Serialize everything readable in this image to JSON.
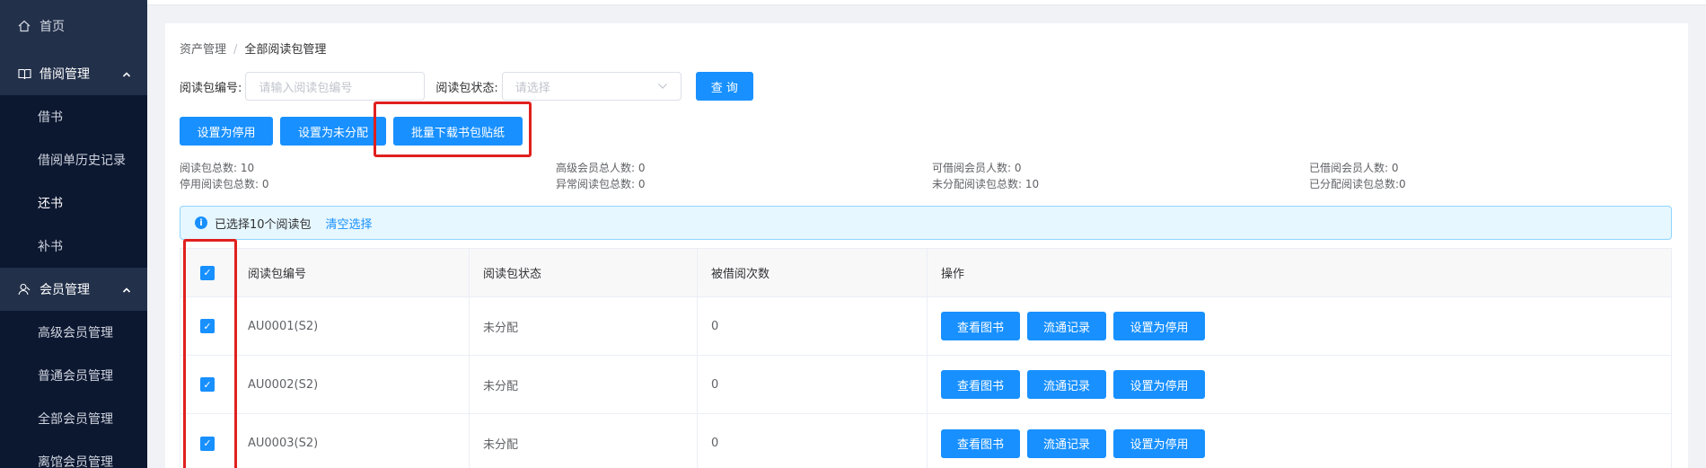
{
  "sidebar": {
    "home": "首页",
    "borrow_group": {
      "label": "借阅管理",
      "items": [
        "借书",
        "借阅单历史记录",
        "还书",
        "补书"
      ]
    },
    "member_group": {
      "label": "会员管理",
      "items": [
        "高级会员管理",
        "普通会员管理",
        "全部会员管理",
        "离馆会员管理"
      ]
    }
  },
  "breadcrumb": {
    "parent": "资产管理",
    "separator": "/",
    "current": "全部阅读包管理"
  },
  "filter": {
    "code_label": "阅读包编号:",
    "code_placeholder": "请输入阅读包编号",
    "status_label": "阅读包状态:",
    "status_placeholder": "请选择",
    "query_button": "查 询"
  },
  "actions": {
    "set_disabled": "设置为停用",
    "set_unassigned": "设置为未分配",
    "batch_download": "批量下载书包贴纸"
  },
  "stats": {
    "total": "阅读包总数: 10",
    "disabled": "停用阅读包总数: 0",
    "premium_members": "高级会员总人数: 0",
    "abnormal": "异常阅读包总数: 0",
    "borrowable_members": "可借阅会员人数: 0",
    "unassigned": "未分配阅读包总数: 10",
    "borrowed_members": "已借阅会员人数: 0",
    "assigned": "已分配阅读包总数:0"
  },
  "alert": {
    "text": "已选择10个阅读包",
    "clear": "清空选择"
  },
  "table": {
    "headers": {
      "code": "阅读包编号",
      "status": "阅读包状态",
      "count": "被借阅次数",
      "ops": "操作"
    },
    "rows": [
      {
        "code": "AU0001(S2)",
        "status": "未分配",
        "count": "0"
      },
      {
        "code": "AU0002(S2)",
        "status": "未分配",
        "count": "0"
      },
      {
        "code": "AU0003(S2)",
        "status": "未分配",
        "count": "0"
      }
    ],
    "row_buttons": {
      "view": "查看图书",
      "flow": "流通记录",
      "disable": "设置为停用"
    }
  },
  "colors": {
    "sidebar_bg": "#22304a",
    "submenu_bg": "#0c1730",
    "primary": "#1890ff",
    "highlight": "#e0201e"
  }
}
